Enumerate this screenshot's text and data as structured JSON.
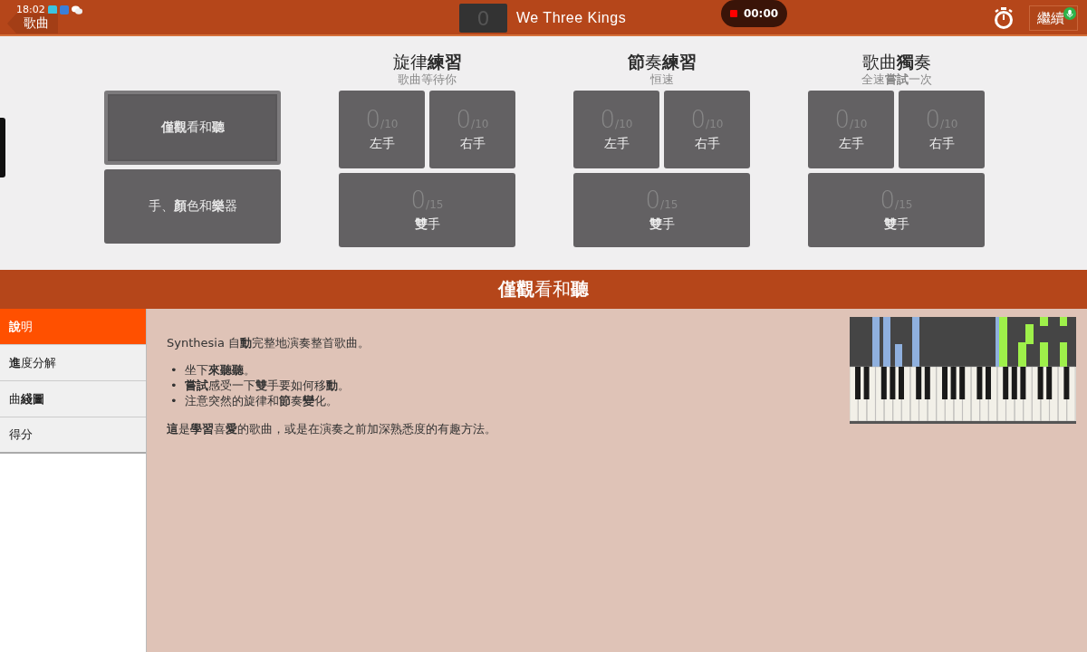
{
  "top_bar": {
    "status_time": "18:02",
    "back_button": "歌曲",
    "score": "0",
    "song_title": "We Three Kings",
    "recording_time": "00:00",
    "continue_button": "繼續"
  },
  "modes": [
    {
      "label": "**僅觀**看和**聽**",
      "selected": true
    },
    {
      "label": "手、**顏**色和**樂**器",
      "selected": false
    }
  ],
  "practice_groups": [
    {
      "title": "旋律**練習**",
      "subtitle": "歌曲等待你",
      "cells": [
        {
          "kind": "half",
          "score": "0",
          "total": "/10",
          "label": "左手"
        },
        {
          "kind": "half",
          "score": "0",
          "total": "/10",
          "label": "右手"
        },
        {
          "kind": "full",
          "score": "0",
          "total": "/15",
          "label": "**雙**手"
        }
      ]
    },
    {
      "title": "**節**奏**練習**",
      "subtitle": "恒速",
      "cells": [
        {
          "kind": "half",
          "score": "0",
          "total": "/10",
          "label": "左手"
        },
        {
          "kind": "half",
          "score": "0",
          "total": "/10",
          "label": "右手"
        },
        {
          "kind": "full",
          "score": "0",
          "total": "/15",
          "label": "**雙**手"
        }
      ]
    },
    {
      "title": "歌曲**獨**奏",
      "subtitle": "全速**嘗試**一次",
      "cells": [
        {
          "kind": "half",
          "score": "0",
          "total": "/10",
          "label": "左手"
        },
        {
          "kind": "half",
          "score": "0",
          "total": "/10",
          "label": "右手"
        },
        {
          "kind": "full",
          "score": "0",
          "total": "/15",
          "label": "**雙**手"
        }
      ]
    }
  ],
  "section_title": "**僅觀**看和**聽**",
  "tabs": [
    {
      "label": "**說**明",
      "selected": true
    },
    {
      "label": "**進**度分解",
      "selected": false
    },
    {
      "label": "曲**綫圖**",
      "selected": false
    },
    {
      "label": "得分",
      "selected": false
    }
  ],
  "description": {
    "intro": "Synthesia  自**動**完整地演奏整首歌曲。",
    "bullets": [
      {
        "marker": "•",
        "text": "坐下**來聽聽**。"
      },
      {
        "marker": "•",
        "text": "**嘗試**感受一下**雙**手要如何移**動**。"
      },
      {
        "marker": "•",
        "text": "注意突然的旋律和**節**奏**變**化。"
      }
    ],
    "closing": "**這**是**學習**喜**愛**的歌曲，或是在演奏之前加深熟悉度的有趣方法。"
  }
}
